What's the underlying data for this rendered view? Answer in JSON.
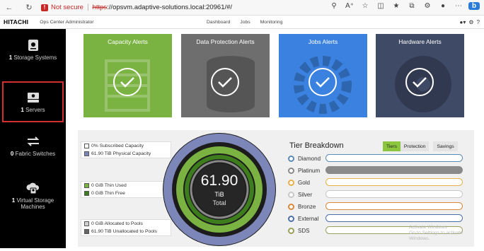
{
  "browser": {
    "security_label": "Not secure",
    "url_protocol": "https",
    "url_rest": "://opsvm.adaptive-solutions.local:20961/#/"
  },
  "app": {
    "logo": "HITACHI",
    "title": "Ops Center Administrator",
    "nav": [
      "Dashboard",
      "Jobs",
      "Monitoring"
    ]
  },
  "sidebar": {
    "items": [
      {
        "count": "1",
        "label": "Storage Systems",
        "icon": "storage-icon"
      },
      {
        "count": "1",
        "label": "Servers",
        "icon": "server-icon",
        "selected": true
      },
      {
        "count": "0",
        "label": "Fabric Switches",
        "icon": "switch-icon"
      },
      {
        "count": "1",
        "label": "Virtual Storage Machines",
        "icon": "vsm-icon"
      }
    ]
  },
  "tiles": [
    {
      "title": "Capacity Alerts",
      "color": "#7ab342"
    },
    {
      "title": "Data Protection Alerts",
      "color": "#6e6e6e"
    },
    {
      "title": "Jobs Alerts",
      "color": "#3b82e0"
    },
    {
      "title": "Hardware Alerts",
      "color": "#3f4a66"
    }
  ],
  "capacity": {
    "subscribed": "0% Subscribed Capacity",
    "physical": "61.90 TiB Physical Capacity",
    "thin_used": "0 GiB Thin Used",
    "thin_free": "0 GiB Thin Free",
    "allocated": "0 GiB Allocated to Pools",
    "unallocated": "61.90 TiB Unallocated to Pools"
  },
  "ring": {
    "value": "61.90",
    "unit": "TiB",
    "label": "Total"
  },
  "tiers": {
    "title": "Tier Breakdown",
    "tabs": [
      "Tiers",
      "Protection",
      "Savings"
    ],
    "active_tab": "Tiers",
    "rows": [
      {
        "name": "Diamond",
        "color": "#5b8ab4",
        "filled": false
      },
      {
        "name": "Platinum",
        "color": "#8a8a8a",
        "filled": true
      },
      {
        "name": "Gold",
        "color": "#e6b04a",
        "filled": false
      },
      {
        "name": "Silver",
        "color": "#c8c8c8",
        "filled": false
      },
      {
        "name": "Bronze",
        "color": "#d9883c",
        "filled": false
      },
      {
        "name": "External",
        "color": "#4c6fa8",
        "filled": false
      },
      {
        "name": "SDS",
        "color": "#9aa05a",
        "filled": false
      }
    ]
  },
  "watermark": {
    "line1": "Activate Windows",
    "line2": "Go to Settings to activate Windows."
  }
}
